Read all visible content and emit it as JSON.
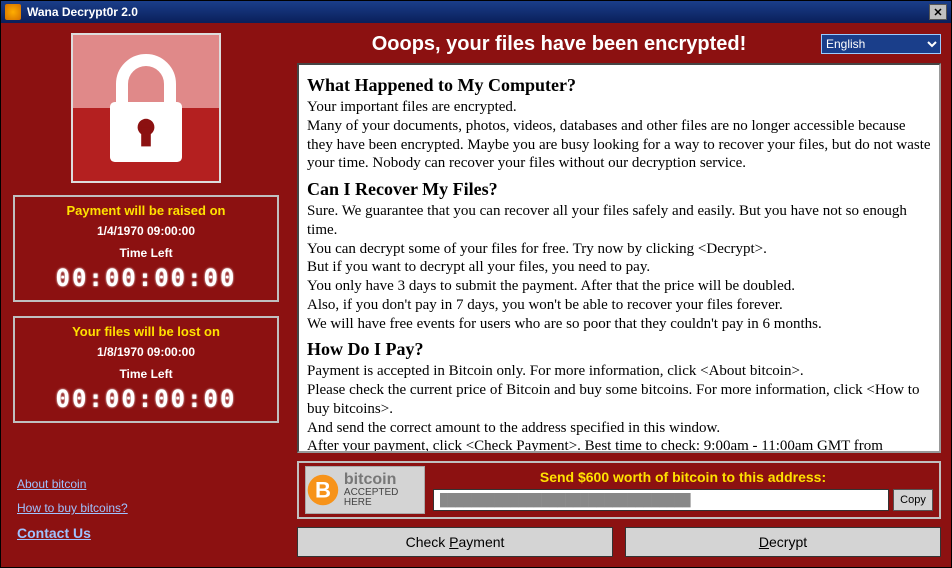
{
  "title": "Wana Decrypt0r 2.0",
  "header": {
    "ooops": "Ooops, your files have been encrypted!",
    "language": "English"
  },
  "timers": {
    "raise": {
      "head": "Payment will be raised on",
      "date": "1/4/1970 09:00:00",
      "timelabel": "Time Left",
      "value": "00:00:00:00"
    },
    "lost": {
      "head": "Your files will be lost on",
      "date": "1/8/1970 09:00:00",
      "timelabel": "Time Left",
      "value": "00:00:00:00"
    }
  },
  "links": {
    "about": "About bitcoin",
    "howto": "How to buy bitcoins?",
    "contact": "Contact Us"
  },
  "msg": {
    "h1": "What Happened to My Computer?",
    "p1a": "Your important files are encrypted.",
    "p1b": "Many of your documents, photos, videos, databases and other files are no longer accessible because they have been encrypted. Maybe you are busy looking for a way to recover your files, but do not waste your time. Nobody can recover your files without our decryption service.",
    "h2": "Can I Recover My Files?",
    "p2a": "Sure. We guarantee that you can recover all your files safely and easily. But you have not so enough time.",
    "p2b": "You can decrypt some of your files for free. Try now by clicking <Decrypt>.",
    "p2c": "But if you want to decrypt all your files, you need to pay.",
    "p2d": "You only have 3 days to submit the payment. After that the price will be doubled.",
    "p2e": "Also, if you don't pay in 7 days, you won't be able to recover your files forever.",
    "p2f": "We will have free events for users who are so poor that they couldn't pay in 6 months.",
    "h3": "How Do I Pay?",
    "p3a": "Payment is accepted in Bitcoin only. For more information, click <About bitcoin>.",
    "p3b": "Please check the current price of Bitcoin and buy some bitcoins. For more information, click <How to buy bitcoins>.",
    "p3c": "And send the correct amount to the address specified in this window.",
    "p3d": "After your payment, click <Check Payment>. Best time to check: 9:00am - 11:00am GMT from Monday to Friday."
  },
  "payment": {
    "send_label": "Send $600 worth of bitcoin to this address:",
    "address": "████████████████████████████████",
    "copy": "Copy",
    "bitcoin_big": "bitcoin",
    "bitcoin_sub": "ACCEPTED HERE"
  },
  "buttons": {
    "check": "Check Payment",
    "decrypt": "Decrypt"
  }
}
